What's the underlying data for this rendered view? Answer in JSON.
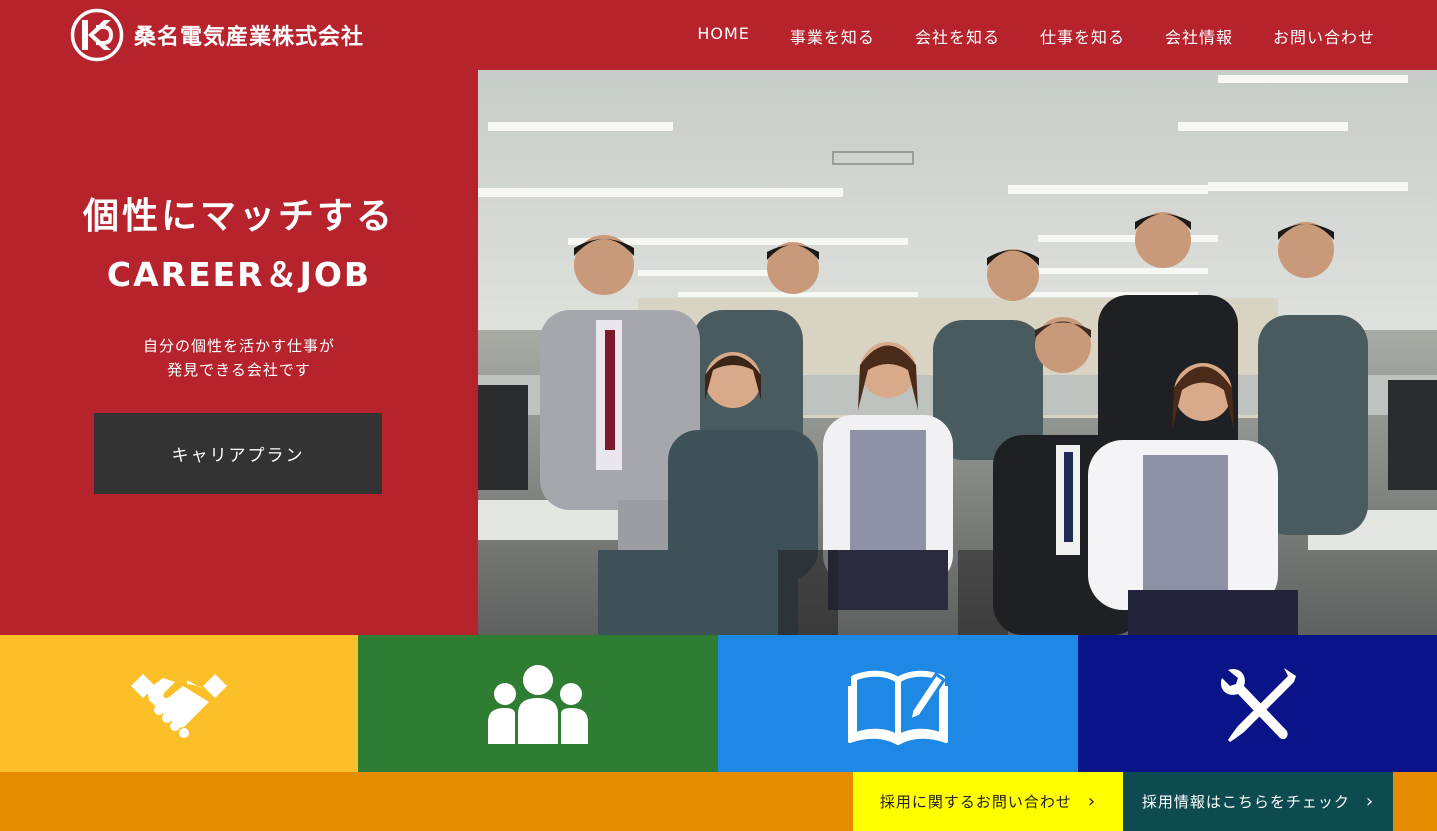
{
  "header": {
    "company_name": "桑名電気産業株式会社",
    "nav": [
      "HOME",
      "事業を知る",
      "会社を知る",
      "仕事を知る",
      "会社情報",
      "お問い合わせ"
    ]
  },
  "hero": {
    "title_line1": "個性にマッチする",
    "title_line2": "CAREER＆JOB",
    "subtitle_line1": "自分の個性を活かす仕事が",
    "subtitle_line2": "発見できる会社です",
    "button_label": "キャリアプラン",
    "photo_icon": "group-photo-of-employees-in-office"
  },
  "tiles": [
    {
      "icon": "handshake-icon",
      "color": "#fbbf27"
    },
    {
      "icon": "people-group-icon",
      "color": "#2e7d32"
    },
    {
      "icon": "book-pen-icon",
      "color": "#1e88e5"
    },
    {
      "icon": "wrench-screwdriver-icon",
      "color": "#0a1387"
    }
  ],
  "cta": {
    "contact_label": "採用に関するお問い合わせ",
    "recruit_label": "採用情報はこちらをチェック",
    "chevron": "›"
  },
  "colors": {
    "brand_red": "#b6232d",
    "bar_orange": "#e68a00",
    "cta_yellow": "#ffff00",
    "cta_teal": "#0d4b50"
  }
}
